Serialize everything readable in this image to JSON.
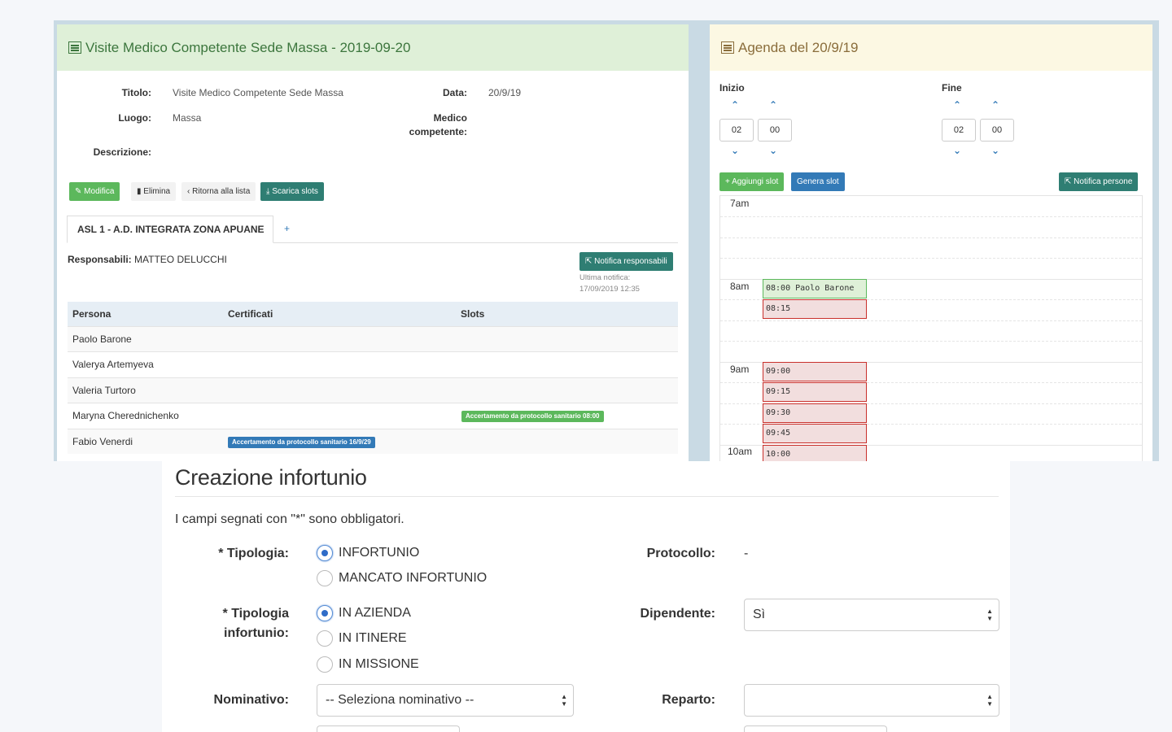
{
  "visit": {
    "title": "Visite Medico Competente Sede Massa - 2019-09-20",
    "fields": {
      "titolo_label": "Titolo:",
      "titolo_value": "Visite Medico Competente Sede Massa",
      "data_label": "Data:",
      "data_value": "20/9/19",
      "luogo_label": "Luogo:",
      "luogo_value": "Massa",
      "medico_label": "Medico",
      "medico_label2": "competente:",
      "descrizione_label": "Descrizione:"
    },
    "buttons": {
      "modifica": "Modifica",
      "elimina": "Elimina",
      "ritorna": "Ritorna alla lista",
      "scarica": "Scarica slots"
    },
    "tab_label": "ASL 1 - A.D. INTEGRATA ZONA APUANE",
    "tab_add": "+",
    "responsabili_label": "Responsabili:",
    "responsabili_value": "MATTEO DELUCCHI",
    "notifica_responsabili": "Notifica responsabili",
    "ultima_notifica_label": "Ultima notifica:",
    "ultima_notifica_value": "17/09/2019 12:35",
    "table": {
      "headers": [
        "Persona",
        "Certificati",
        "Slots"
      ],
      "rows": [
        {
          "persona": "Paolo Barone",
          "certificato": "",
          "slot": ""
        },
        {
          "persona": "Valerya Artemyeva",
          "certificato": "",
          "slot": ""
        },
        {
          "persona": "Valeria Turtoro",
          "certificato": "",
          "slot": ""
        },
        {
          "persona": "Maryna Cherednichenko",
          "certificato": "",
          "slot": "Accertamento da protocollo sanitario 08:00"
        },
        {
          "persona": "Fabio Venerdi",
          "certificato": "Accertamento da protocollo sanitario 16/9/29",
          "slot": ""
        }
      ]
    }
  },
  "agenda": {
    "title": "Agenda del 20/9/19",
    "inizio_label": "Inizio",
    "fine_label": "Fine",
    "inizio_h": "02",
    "inizio_m": "00",
    "fine_h": "02",
    "fine_m": "00",
    "buttons": {
      "aggiungi": "Aggiungi slot",
      "genera": "Genera slot",
      "notifica": "Notifica persone"
    },
    "hours": [
      "7am",
      "8am",
      "9am",
      "10am"
    ],
    "slots": [
      "08:00 Paolo Barone",
      "08:15",
      "09:00",
      "09:15",
      "09:30",
      "09:45",
      "10:00"
    ]
  },
  "form": {
    "title": "Creazione infortunio",
    "note": "I campi segnati con \"*\" sono obbligatori.",
    "tipologia_label": "* Tipologia:",
    "tipologia_options": [
      "INFORTUNIO",
      "MANCATO INFORTUNIO"
    ],
    "tipologia_inf_label1": "* Tipologia",
    "tipologia_inf_label2": "infortunio:",
    "tipologia_inf_options": [
      "IN AZIENDA",
      "IN ITINERE",
      "IN MISSIONE"
    ],
    "protocollo_label": "Protocollo:",
    "protocollo_value": "-",
    "dipendente_label": "Dipendente:",
    "dipendente_value": "Sì",
    "nominativo_label": "Nominativo:",
    "nominativo_value": "-- Seleziona nominativo --",
    "reparto_label": "Reparto:",
    "reparto_value": ""
  },
  "colors": {
    "green": "#5cb85c",
    "teal": "#2f7e73",
    "blue": "#337ab7",
    "slot_red": "#c9302c"
  }
}
